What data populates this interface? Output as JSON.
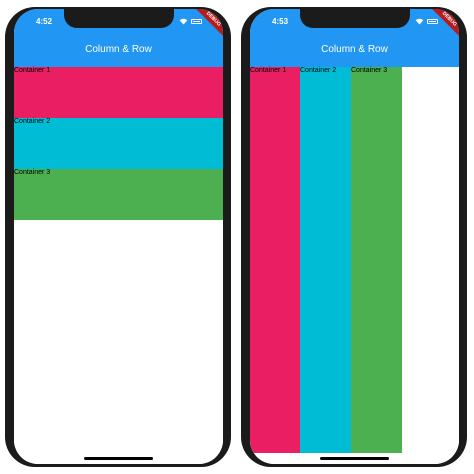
{
  "screens": [
    {
      "status_time": "4:52",
      "app_title": "Column & Row",
      "debug_banner": "DEBUG",
      "containers": [
        {
          "label": "Container 1",
          "color": "#e91e63"
        },
        {
          "label": "Container 2",
          "color": "#00bcd4"
        },
        {
          "label": "Container 3",
          "color": "#4caf50"
        }
      ]
    },
    {
      "status_time": "4:53",
      "app_title": "Column & Row",
      "debug_banner": "DEBUG",
      "containers": [
        {
          "label": "Container 1",
          "color": "#e91e63"
        },
        {
          "label": "Container 2",
          "color": "#00bcd4"
        },
        {
          "label": "Container 3",
          "color": "#4caf50"
        }
      ]
    }
  ],
  "colors": {
    "app_bar": "#2196f3",
    "debug_banner": "#b71c1c"
  }
}
